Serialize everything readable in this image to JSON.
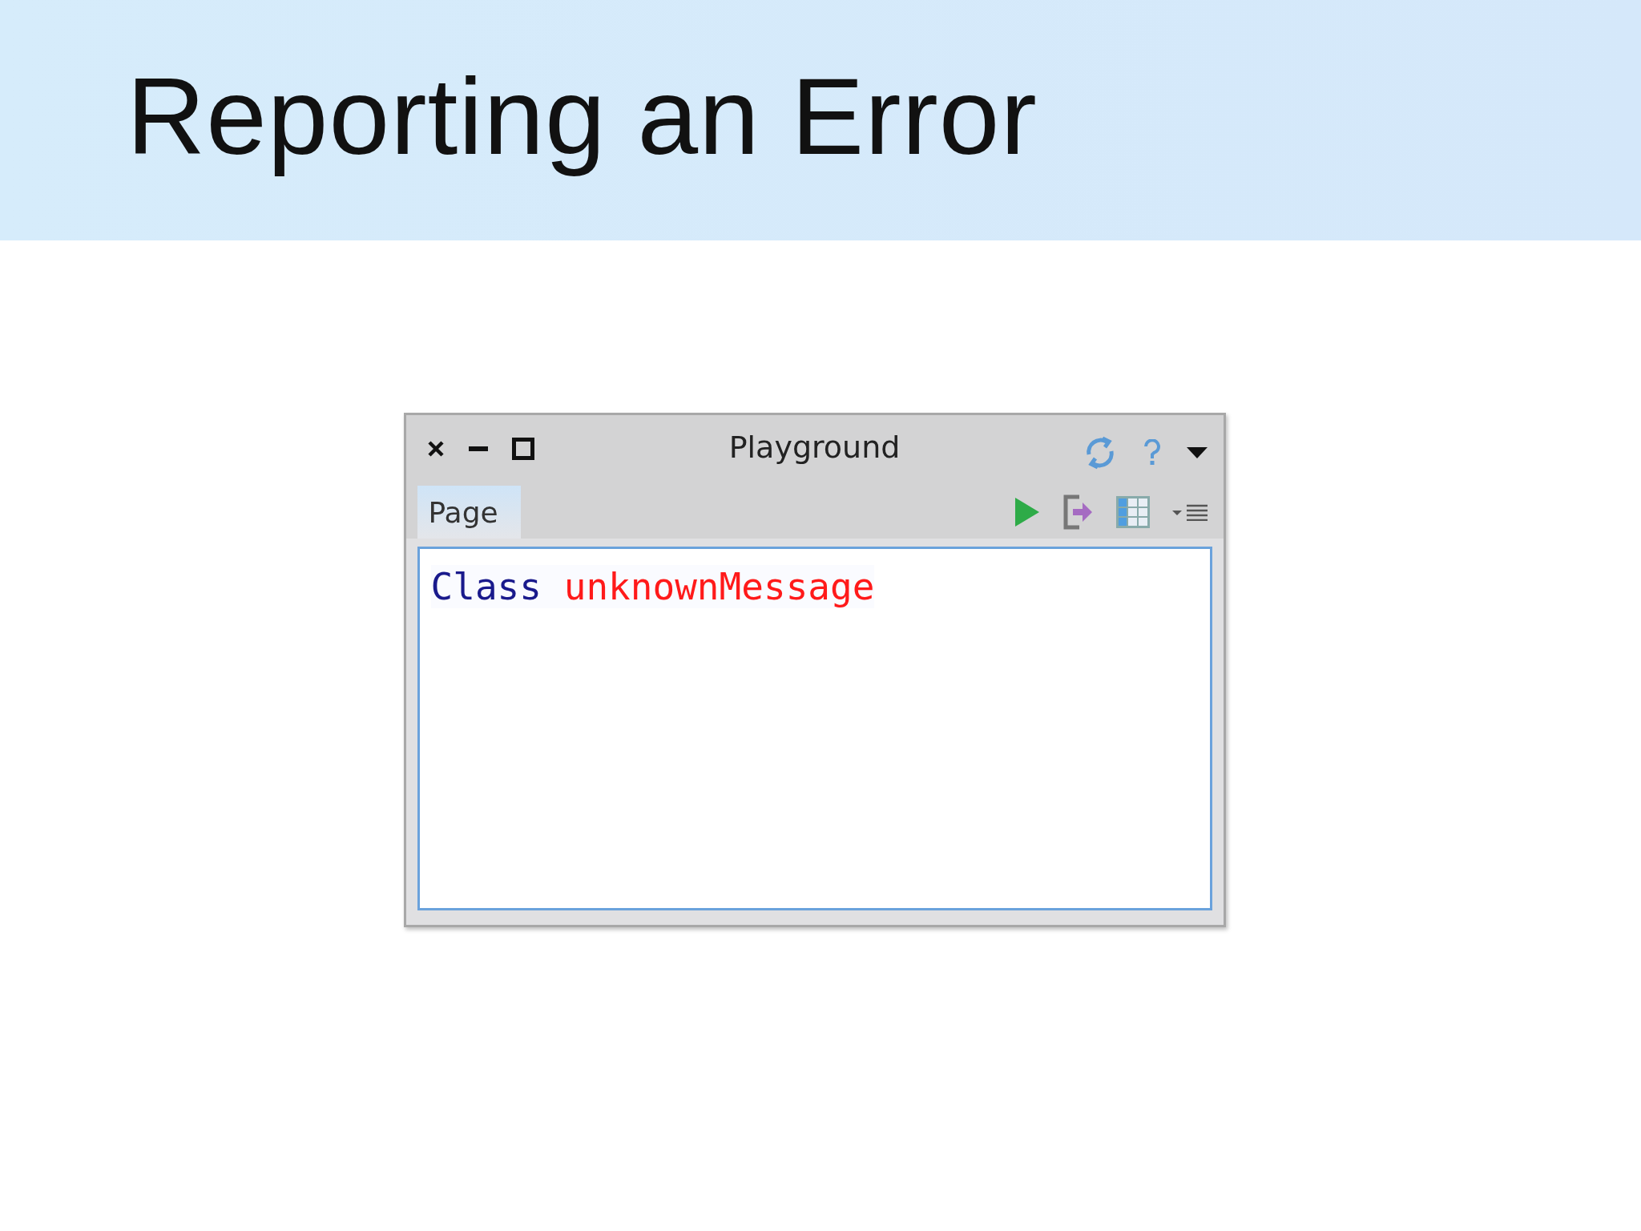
{
  "slide_title": "Reporting an Error",
  "window": {
    "title": "Playground",
    "tabs": [
      {
        "label": "Page",
        "selected": true
      }
    ],
    "editor": {
      "tokens": [
        {
          "text": "Class",
          "kind": "global"
        },
        {
          "text": "unknownMessage",
          "kind": "error"
        }
      ]
    }
  }
}
